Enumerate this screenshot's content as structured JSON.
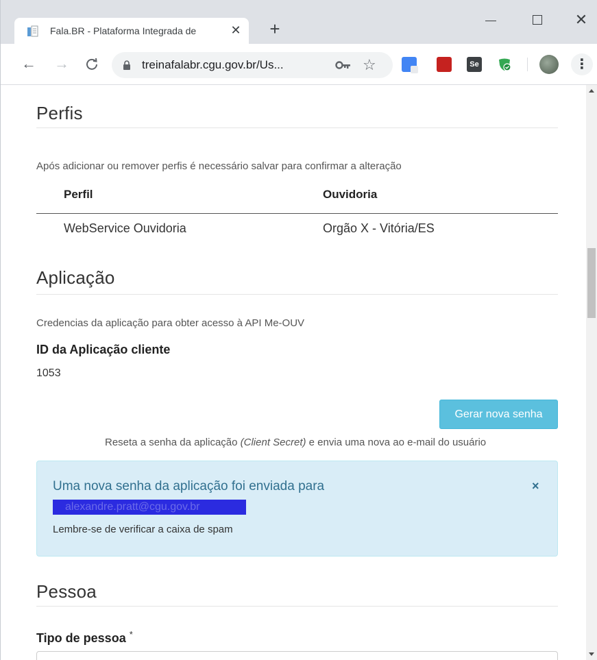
{
  "browser": {
    "tab_title": "Fala.BR - Plataforma Integrada de",
    "tab_close": "✕",
    "new_tab": "+",
    "url": "treinafalabr.cgu.gov.br/Us...",
    "win_close": "✕",
    "ext_se_label": "Se",
    "menu_glyph": "⋮",
    "icons": [
      "document-icon",
      "lock-icon",
      "key-icon",
      "star-icon",
      "translate-icon",
      "pdf-icon",
      "selenium-icon",
      "shield-icon",
      "avatar",
      "menu-icon"
    ]
  },
  "nav": {
    "back": "←",
    "forward": "→",
    "reload": "C"
  },
  "perfis": {
    "title": "Perfis",
    "note": "Após adicionar ou remover perfis é necessário salvar para confirmar a alteração",
    "columns": [
      "Perfil",
      "Ouvidoria"
    ],
    "rows": [
      [
        "WebService Ouvidoria",
        "Orgão X - Vitória/ES"
      ]
    ]
  },
  "aplicacao": {
    "title": "Aplicação",
    "note": "Credencias da aplicação para obter acesso à API Me-OUV",
    "id_label": "ID da Aplicação cliente",
    "id_value": "1053",
    "button_label": "Gerar nova senha",
    "helper_before": "Reseta a senha da aplicação ",
    "helper_em": "(Client Secret)",
    "helper_after": " e envia uma nova ao e-mail do usuário"
  },
  "alert": {
    "title": "Uma nova senha da aplicação foi enviada para",
    "email_redacted": "alexandre.pratt@cgu.gov.br",
    "note": "Lembre-se de verificar a caixa de spam",
    "close": "×"
  },
  "pessoa": {
    "title": "Pessoa",
    "tipo_label": "Tipo de pessoa",
    "required_mark": "*"
  },
  "colors": {
    "primary_button": "#5bc0de",
    "alert_bg": "#d9edf7",
    "alert_text": "#31708f",
    "redaction": "#2b2be0"
  }
}
